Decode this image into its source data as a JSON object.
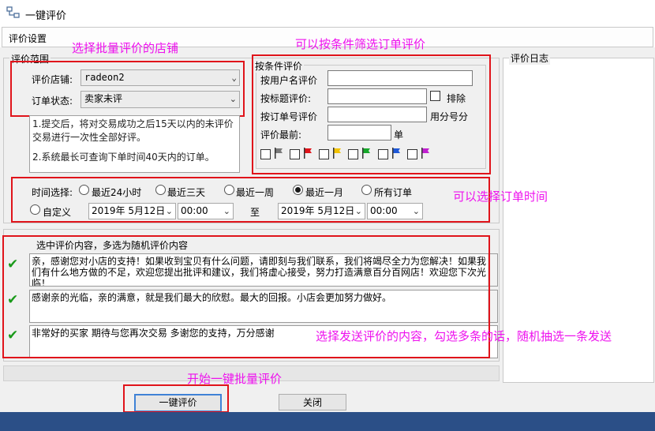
{
  "window": {
    "title": "一键评价"
  },
  "tabs": {
    "active": "评价设置"
  },
  "scope_group": {
    "legend": "评价范围"
  },
  "shop": {
    "label": "评价店铺:",
    "value": "radeon2"
  },
  "order_status": {
    "label": "订单状态:",
    "value": "卖家未评"
  },
  "info_text": {
    "line1": "1.提交后，将对交易成功之后15天以内的未评价交易进行一次性全部好评。",
    "line2": "2.系统最长可查询下单时间40天内的订单。"
  },
  "filter": {
    "legend": "按条件评价",
    "by_user_label": "按用户名评价",
    "by_title_label": "按标题评价:",
    "exclude_label": "排除",
    "by_order_label": "按订单号评价",
    "order_suffix": "用分号分",
    "before_label": "评价最前:",
    "before_unit": "单",
    "flags": [
      {
        "icon": "gray-flag-icon",
        "color": "#7a7a7a"
      },
      {
        "icon": "red-flag-icon",
        "color": "#e0141b"
      },
      {
        "icon": "yellow-flag-icon",
        "color": "#f2c200"
      },
      {
        "icon": "green-flag-icon",
        "color": "#16a82a"
      },
      {
        "icon": "blue-flag-icon",
        "color": "#1e58d8"
      },
      {
        "icon": "purple-flag-icon",
        "color": "#c020d0"
      }
    ]
  },
  "time": {
    "label": "时间选择:",
    "options": [
      "最近24小时",
      "最近三天",
      "最近一周",
      "最近一月",
      "所有订单"
    ],
    "selected": "最近一月",
    "custom_label": "自定义",
    "start_date": "2019年 5月12日",
    "start_time": "00:00",
    "to_label": "至",
    "end_date": "2019年 5月12日",
    "end_time": "00:00"
  },
  "content": {
    "header": "选中评价内容，多选为随机评价内容",
    "items": [
      {
        "checked": true,
        "text": "亲，感谢您对小店的支持！如果收到宝贝有什么问题，请即刻与我们联系，我们将竭尽全力为您解决！如果我们有什么地方做的不足，欢迎您提出批评和建议，我们将虚心接受，努力打造满意百分百网店！欢迎您下次光临！"
      },
      {
        "checked": true,
        "text": "感谢亲的光临，亲的满意，就是我们最大的欣慰。最大的回报。小店会更加努力做好。"
      },
      {
        "checked": true,
        "text": "非常好的买家 期待与您再次交易 多谢您的支持，万分感谢"
      }
    ]
  },
  "log": {
    "legend": "评价日志"
  },
  "buttons": {
    "start": "一键评价",
    "close": "关闭"
  },
  "annotations": {
    "shop": "选择批量评价的店铺",
    "filter": "可以按条件筛选订单评价",
    "time": "可以选择订单时间",
    "content": "选择发送评价的内容，勾选多条的话，随机抽选一条发送",
    "start": "开始一键批量评价"
  },
  "colors": {
    "highlight_box": "#e0141b",
    "annotation_text": "#ee11ee",
    "status_bar": "#2b4f87",
    "check_mark": "#1a9a1a"
  }
}
